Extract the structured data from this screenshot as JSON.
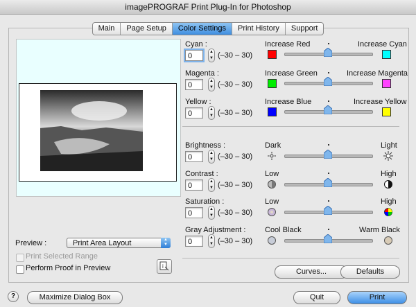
{
  "window": {
    "title": "imagePROGRAF Print Plug-In for Photoshop"
  },
  "tabs": [
    {
      "label": "Main",
      "active": false
    },
    {
      "label": "Page Setup",
      "active": false
    },
    {
      "label": "Color Settings",
      "active": true
    },
    {
      "label": "Print History",
      "active": false
    },
    {
      "label": "Support",
      "active": false
    }
  ],
  "color": {
    "cyan": {
      "label": "Cyan :",
      "value": "0",
      "range": "(–30 – 30)",
      "left": "Increase Red",
      "right": "Increase Cyan",
      "left_color": "#ff0000",
      "right_color": "#00ffff",
      "level": 0
    },
    "magenta": {
      "label": "Magenta :",
      "value": "0",
      "range": "(–30 – 30)",
      "left": "Increase Green",
      "right": "Increase Magenta",
      "left_color": "#00ee00",
      "right_color": "#ff44ff",
      "level": 0
    },
    "yellow": {
      "label": "Yellow :",
      "value": "0",
      "range": "(–30 – 30)",
      "left": "Increase Blue",
      "right": "Increase Yellow",
      "left_color": "#0000ff",
      "right_color": "#ffff00",
      "level": 0
    }
  },
  "tone": {
    "brightness": {
      "label": "Brightness :",
      "value": "0",
      "range": "(–30 – 30)",
      "left": "Dark",
      "right": "Light",
      "level": 0
    },
    "contrast": {
      "label": "Contrast :",
      "value": "0",
      "range": "(–30 – 30)",
      "left": "Low",
      "right": "High",
      "level": 0
    },
    "saturation": {
      "label": "Saturation :",
      "value": "0",
      "range": "(–30 – 30)",
      "left": "Low",
      "right": "High",
      "level": 0
    },
    "gray": {
      "label": "Gray Adjustment :",
      "value": "0",
      "range": "(–30 – 30)",
      "left": "Cool Black",
      "right": "Warm Black",
      "level": 0
    }
  },
  "preview": {
    "label": "Preview :",
    "selected": "Print Area Layout",
    "print_selected_range": "Print Selected Range",
    "perform_proof": "Perform Proof in Preview"
  },
  "buttons": {
    "curves": "Curves...",
    "defaults": "Defaults",
    "maximize": "Maximize Dialog Box",
    "quit": "Quit",
    "print": "Print",
    "help": "?"
  },
  "icons": {
    "help": "help-icon",
    "preview_info": "preview-info-icon",
    "sun_dark": "sun-dim-icon",
    "sun_light": "sun-bright-icon",
    "contrast_low": "contrast-low-icon",
    "contrast_high": "contrast-high-icon",
    "sat_low": "saturation-low-icon",
    "sat_high": "saturation-high-icon",
    "cool_black": "cool-black-icon",
    "warm_black": "warm-black-icon"
  }
}
